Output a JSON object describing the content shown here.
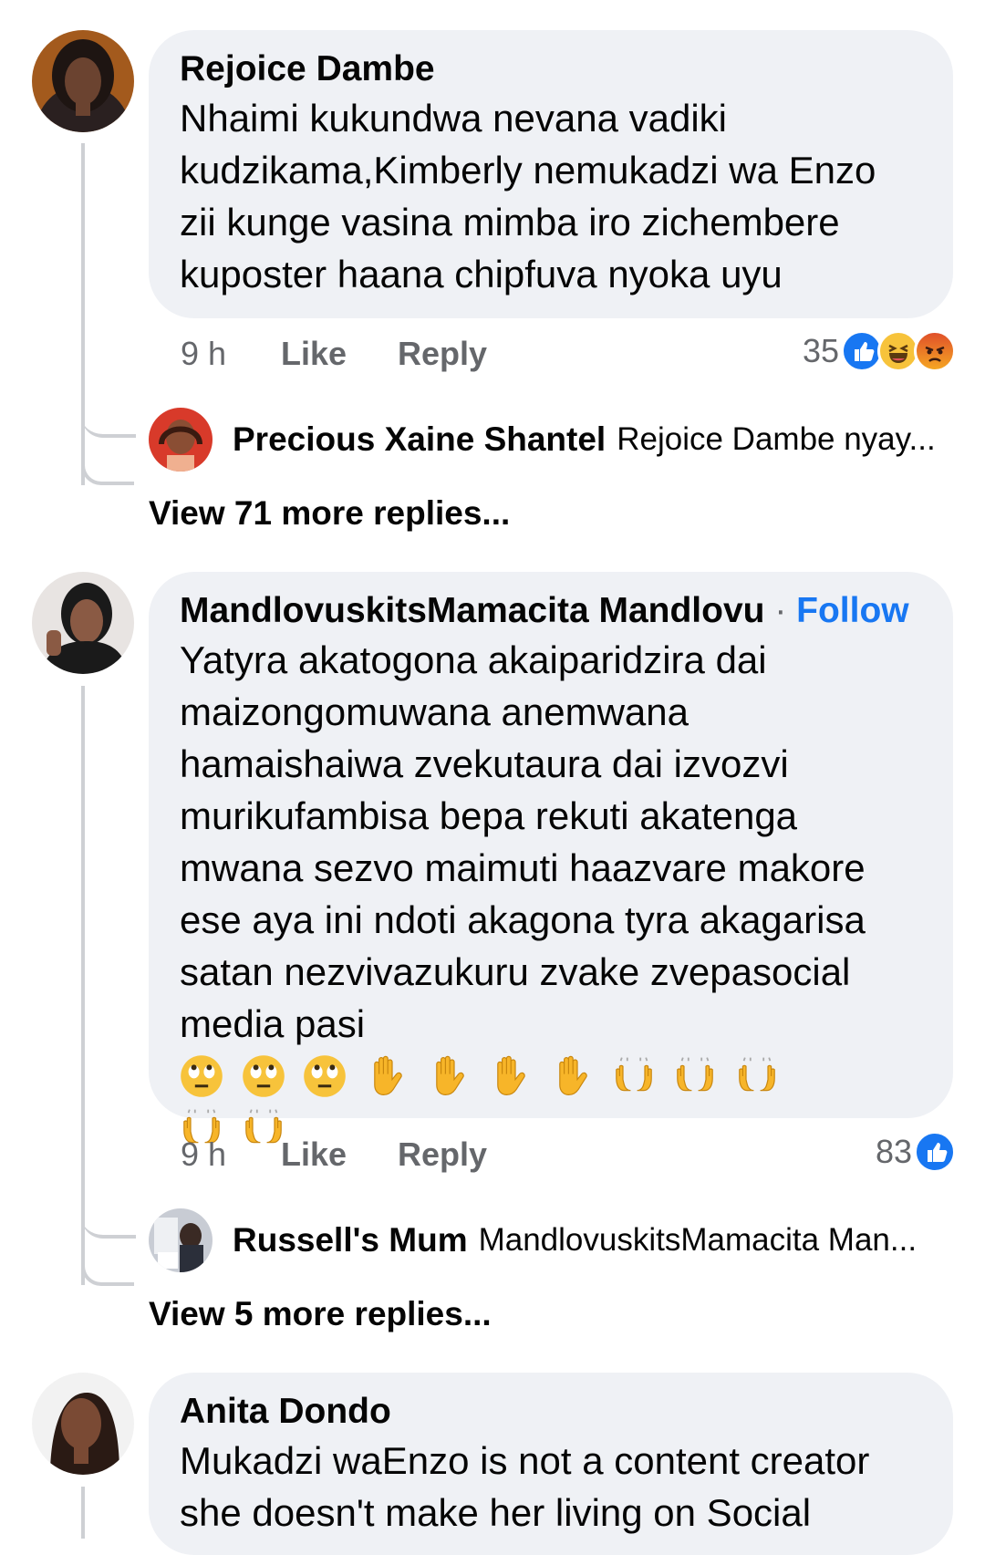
{
  "comments": [
    {
      "author": "Rejoice Dambe",
      "lines": [
        "Nhaimi kukundwa nevana vadiki",
        "kudzikama,Kimberly nemukadzi wa Enzo",
        "zii kunge vasina mimba iro zichembere",
        "kuposter haana chipfuva nyoka uyu"
      ],
      "time": "9 h",
      "like_label": "Like",
      "reply_label": "Reply",
      "reaction_count": "35",
      "reactions": [
        "like-reaction-icon",
        "haha-reaction-icon",
        "angry-reaction-icon"
      ],
      "reply": {
        "name": "Precious Xaine Shantel",
        "snippet": "Rejoice Dambe nyay..."
      },
      "view_more": "View 71 more replies..."
    },
    {
      "author": "MandlovuskitsMamacita Mandlovu",
      "follow_sep": "·",
      "follow_label": "Follow",
      "lines": [
        "Yatyra akatogona akaiparidzira dai",
        "maizongomuwana anemwana",
        "hamaishaiwa zvekutaura dai izvozvi",
        "murikufambisa bepa rekuti akatenga",
        "mwana sezvo maimuti haazvare makore",
        "ese aya ini ndoti akagona tyra akagarisa",
        "satan nezvivazukuru zvake zvepasocial",
        "media pasi"
      ],
      "emojis_line1": [
        "eye-roll-emoji",
        "eye-roll-emoji",
        "eye-roll-emoji",
        "raised-hand-emoji",
        "raised-hand-emoji",
        "raised-hand-emoji",
        "raised-hand-emoji",
        "raising-hands-emoji",
        "raising-hands-emoji",
        "raising-hands-emoji"
      ],
      "emojis_line2": [
        "raising-hands-emoji",
        "raising-hands-emoji"
      ],
      "time": "9 h",
      "like_label": "Like",
      "reply_label": "Reply",
      "reaction_count": "83",
      "reactions": [
        "like-reaction-icon"
      ],
      "reply": {
        "name": "Russell's Mum",
        "snippet": "MandlovuskitsMamacita Man..."
      },
      "view_more": "View 5 more replies..."
    },
    {
      "author": "Anita Dondo",
      "lines": [
        "Mukadzi waEnzo is not a content creator",
        "she doesn't make her living on Social"
      ]
    }
  ],
  "colors": {
    "link": "#1877f2",
    "bubble": "#eff1f5",
    "meta": "#65676b",
    "thread": "#ced0d4"
  }
}
